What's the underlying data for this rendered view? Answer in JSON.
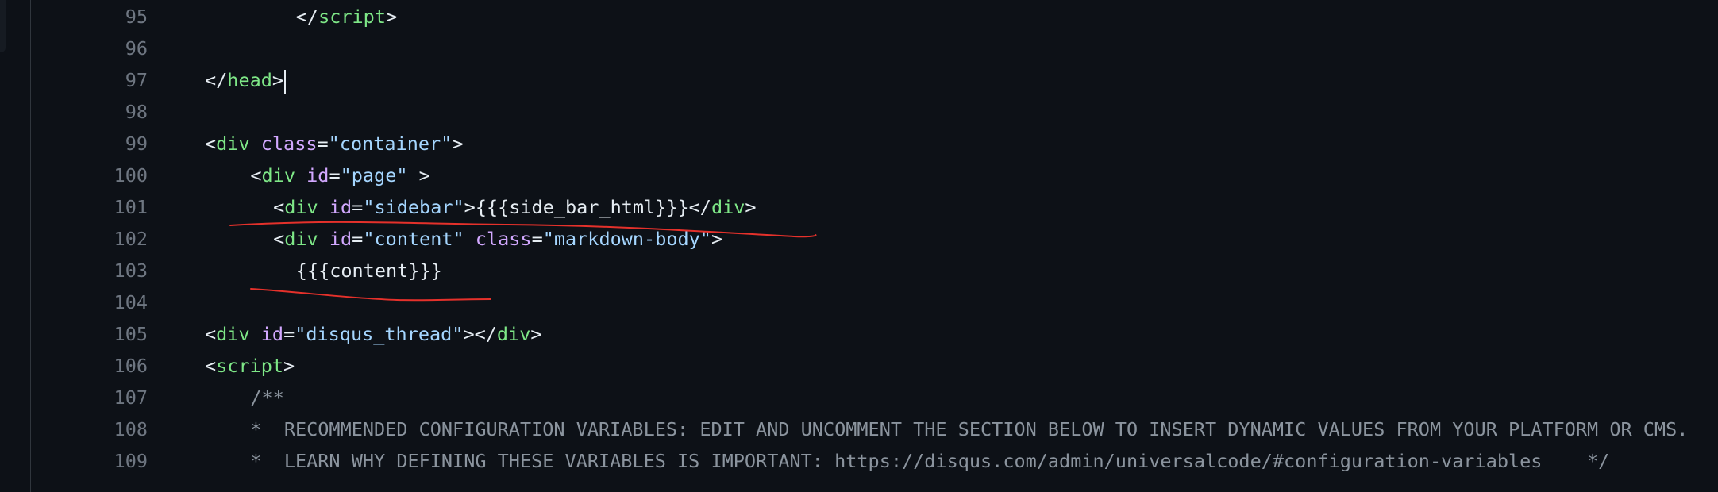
{
  "editor": {
    "lines": [
      {
        "num": "95",
        "indent": 8,
        "tokens": [
          [
            "punct",
            "</"
          ],
          [
            "tag",
            "script"
          ],
          [
            "punct",
            ">"
          ]
        ]
      },
      {
        "num": "96",
        "indent": 0,
        "tokens": []
      },
      {
        "num": "97",
        "indent": 0,
        "tokens": [
          [
            "punct",
            "</"
          ],
          [
            "tag",
            "head"
          ],
          [
            "punct",
            ">"
          ]
        ],
        "caret": true
      },
      {
        "num": "98",
        "indent": 0,
        "tokens": []
      },
      {
        "num": "99",
        "indent": 0,
        "tokens": [
          [
            "punct",
            "<"
          ],
          [
            "tag",
            "div"
          ],
          [
            "punct",
            " "
          ],
          [
            "attr",
            "class"
          ],
          [
            "punct",
            "="
          ],
          [
            "str",
            "\"container\""
          ],
          [
            "punct",
            ">"
          ]
        ]
      },
      {
        "num": "100",
        "indent": 4,
        "tokens": [
          [
            "punct",
            "<"
          ],
          [
            "tag",
            "div"
          ],
          [
            "punct",
            " "
          ],
          [
            "attr",
            "id"
          ],
          [
            "punct",
            "="
          ],
          [
            "str",
            "\"page\""
          ],
          [
            "punct",
            " >"
          ]
        ]
      },
      {
        "num": "101",
        "indent": 6,
        "tokens": [
          [
            "punct",
            "<"
          ],
          [
            "tag",
            "div"
          ],
          [
            "punct",
            " "
          ],
          [
            "attr",
            "id"
          ],
          [
            "punct",
            "="
          ],
          [
            "str",
            "\"sidebar\""
          ],
          [
            "punct",
            ">"
          ],
          [
            "text",
            "{{{side_bar_html}}}"
          ],
          [
            "punct",
            "</"
          ],
          [
            "tag",
            "div"
          ],
          [
            "punct",
            ">"
          ]
        ]
      },
      {
        "num": "102",
        "indent": 6,
        "tokens": [
          [
            "punct",
            "<"
          ],
          [
            "tag",
            "div"
          ],
          [
            "punct",
            " "
          ],
          [
            "attr",
            "id"
          ],
          [
            "punct",
            "="
          ],
          [
            "str",
            "\"content\""
          ],
          [
            "punct",
            " "
          ],
          [
            "attr",
            "class"
          ],
          [
            "punct",
            "="
          ],
          [
            "str",
            "\"markdown-body\""
          ],
          [
            "punct",
            ">"
          ]
        ]
      },
      {
        "num": "103",
        "indent": 8,
        "tokens": [
          [
            "text",
            "{{{content}}}"
          ]
        ]
      },
      {
        "num": "104",
        "indent": 0,
        "tokens": []
      },
      {
        "num": "105",
        "indent": 0,
        "tokens": [
          [
            "punct",
            "<"
          ],
          [
            "tag",
            "div"
          ],
          [
            "punct",
            " "
          ],
          [
            "attr",
            "id"
          ],
          [
            "punct",
            "="
          ],
          [
            "str",
            "\"disqus_thread\""
          ],
          [
            "punct",
            "></"
          ],
          [
            "tag",
            "div"
          ],
          [
            "punct",
            ">"
          ]
        ]
      },
      {
        "num": "106",
        "indent": 0,
        "tokens": [
          [
            "punct",
            "<"
          ],
          [
            "tag",
            "script"
          ],
          [
            "punct",
            ">"
          ]
        ]
      },
      {
        "num": "107",
        "indent": 4,
        "tokens": [
          [
            "comment",
            "/**"
          ]
        ]
      },
      {
        "num": "108",
        "indent": 4,
        "tokens": [
          [
            "comment",
            "*  RECOMMENDED CONFIGURATION VARIABLES: EDIT AND UNCOMMENT THE SECTION BELOW TO INSERT DYNAMIC VALUES FROM YOUR PLATFORM OR CMS."
          ]
        ]
      },
      {
        "num": "109",
        "indent": 4,
        "tokens": [
          [
            "comment",
            "*  LEARN WHY DEFINING THESE VARIABLES IS IMPORTANT: https://disqus.com/admin/universalcode/#configuration-variables    */"
          ]
        ]
      }
    ]
  },
  "colors": {
    "background": "#0d1117",
    "tag": "#7ee787",
    "attribute": "#d2a8ff",
    "string": "#a5d6ff",
    "text": "#e6edf3",
    "comment": "#8b949e",
    "line_number": "#6e7681",
    "annotation": "#e5312b"
  }
}
